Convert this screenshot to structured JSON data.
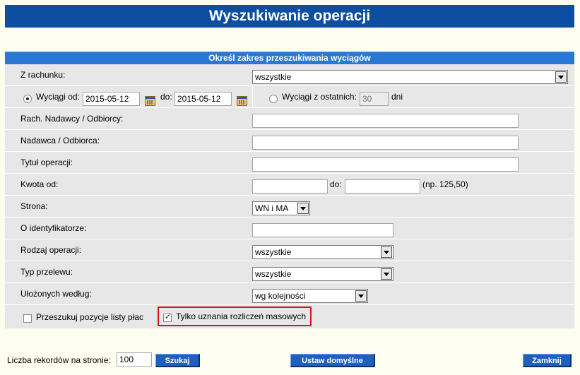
{
  "title": "Wyszukiwanie operacji",
  "section_header": "Określ zakres przeszukiwania wyciągów",
  "account": {
    "label": "Z rachunku:",
    "value": "wszystkie"
  },
  "date_range": {
    "from_label": "Wyciągi od:",
    "from_value": "2015-05-12",
    "to_label": "do:",
    "to_value": "2015-05-12",
    "selected": true
  },
  "last_days": {
    "label": "Wyciągi z ostatnich:",
    "value": "30",
    "suffix": "dni",
    "selected": false
  },
  "sender_account": {
    "label": "Rach. Nadawcy / Odbiorcy:",
    "value": ""
  },
  "sender": {
    "label": "Nadawca / Odbiorca:",
    "value": ""
  },
  "operation_title": {
    "label": "Tytuł operacji:",
    "value": ""
  },
  "amount": {
    "label": "Kwota od:",
    "from_value": "",
    "to_label": "do:",
    "to_value": "",
    "hint": "(np. 125,50)"
  },
  "side": {
    "label": "Strona:",
    "value": "WN i MA"
  },
  "identifier": {
    "label": "O identyfikatorze:",
    "value": ""
  },
  "operation_type": {
    "label": "Rodzaj operacji:",
    "value": "wszystkie"
  },
  "transfer_type": {
    "label": "Typ przelewu:",
    "value": "wszystkie"
  },
  "sort": {
    "label": "Ułożonych według:",
    "value": "wg kolejności"
  },
  "checkboxes": {
    "payroll": {
      "label": "Przeszukuj pozycje listy płac",
      "checked": false
    },
    "mass_credits": {
      "label": "Tylko uznania rozliczeń masowych",
      "checked": true
    }
  },
  "footer": {
    "records_label": "Liczba rekordów na stronie:",
    "records_value": "100",
    "search_button": "Szukaj",
    "defaults_button": "Ustaw domyślne",
    "close_button": "Zamknij"
  },
  "colors": {
    "title_bg": "#0b4ea2",
    "header_bg": "#2a78d6",
    "form_bg": "#e7e7e7",
    "page_bg": "#fdfdf0",
    "highlight": "#d01818"
  }
}
